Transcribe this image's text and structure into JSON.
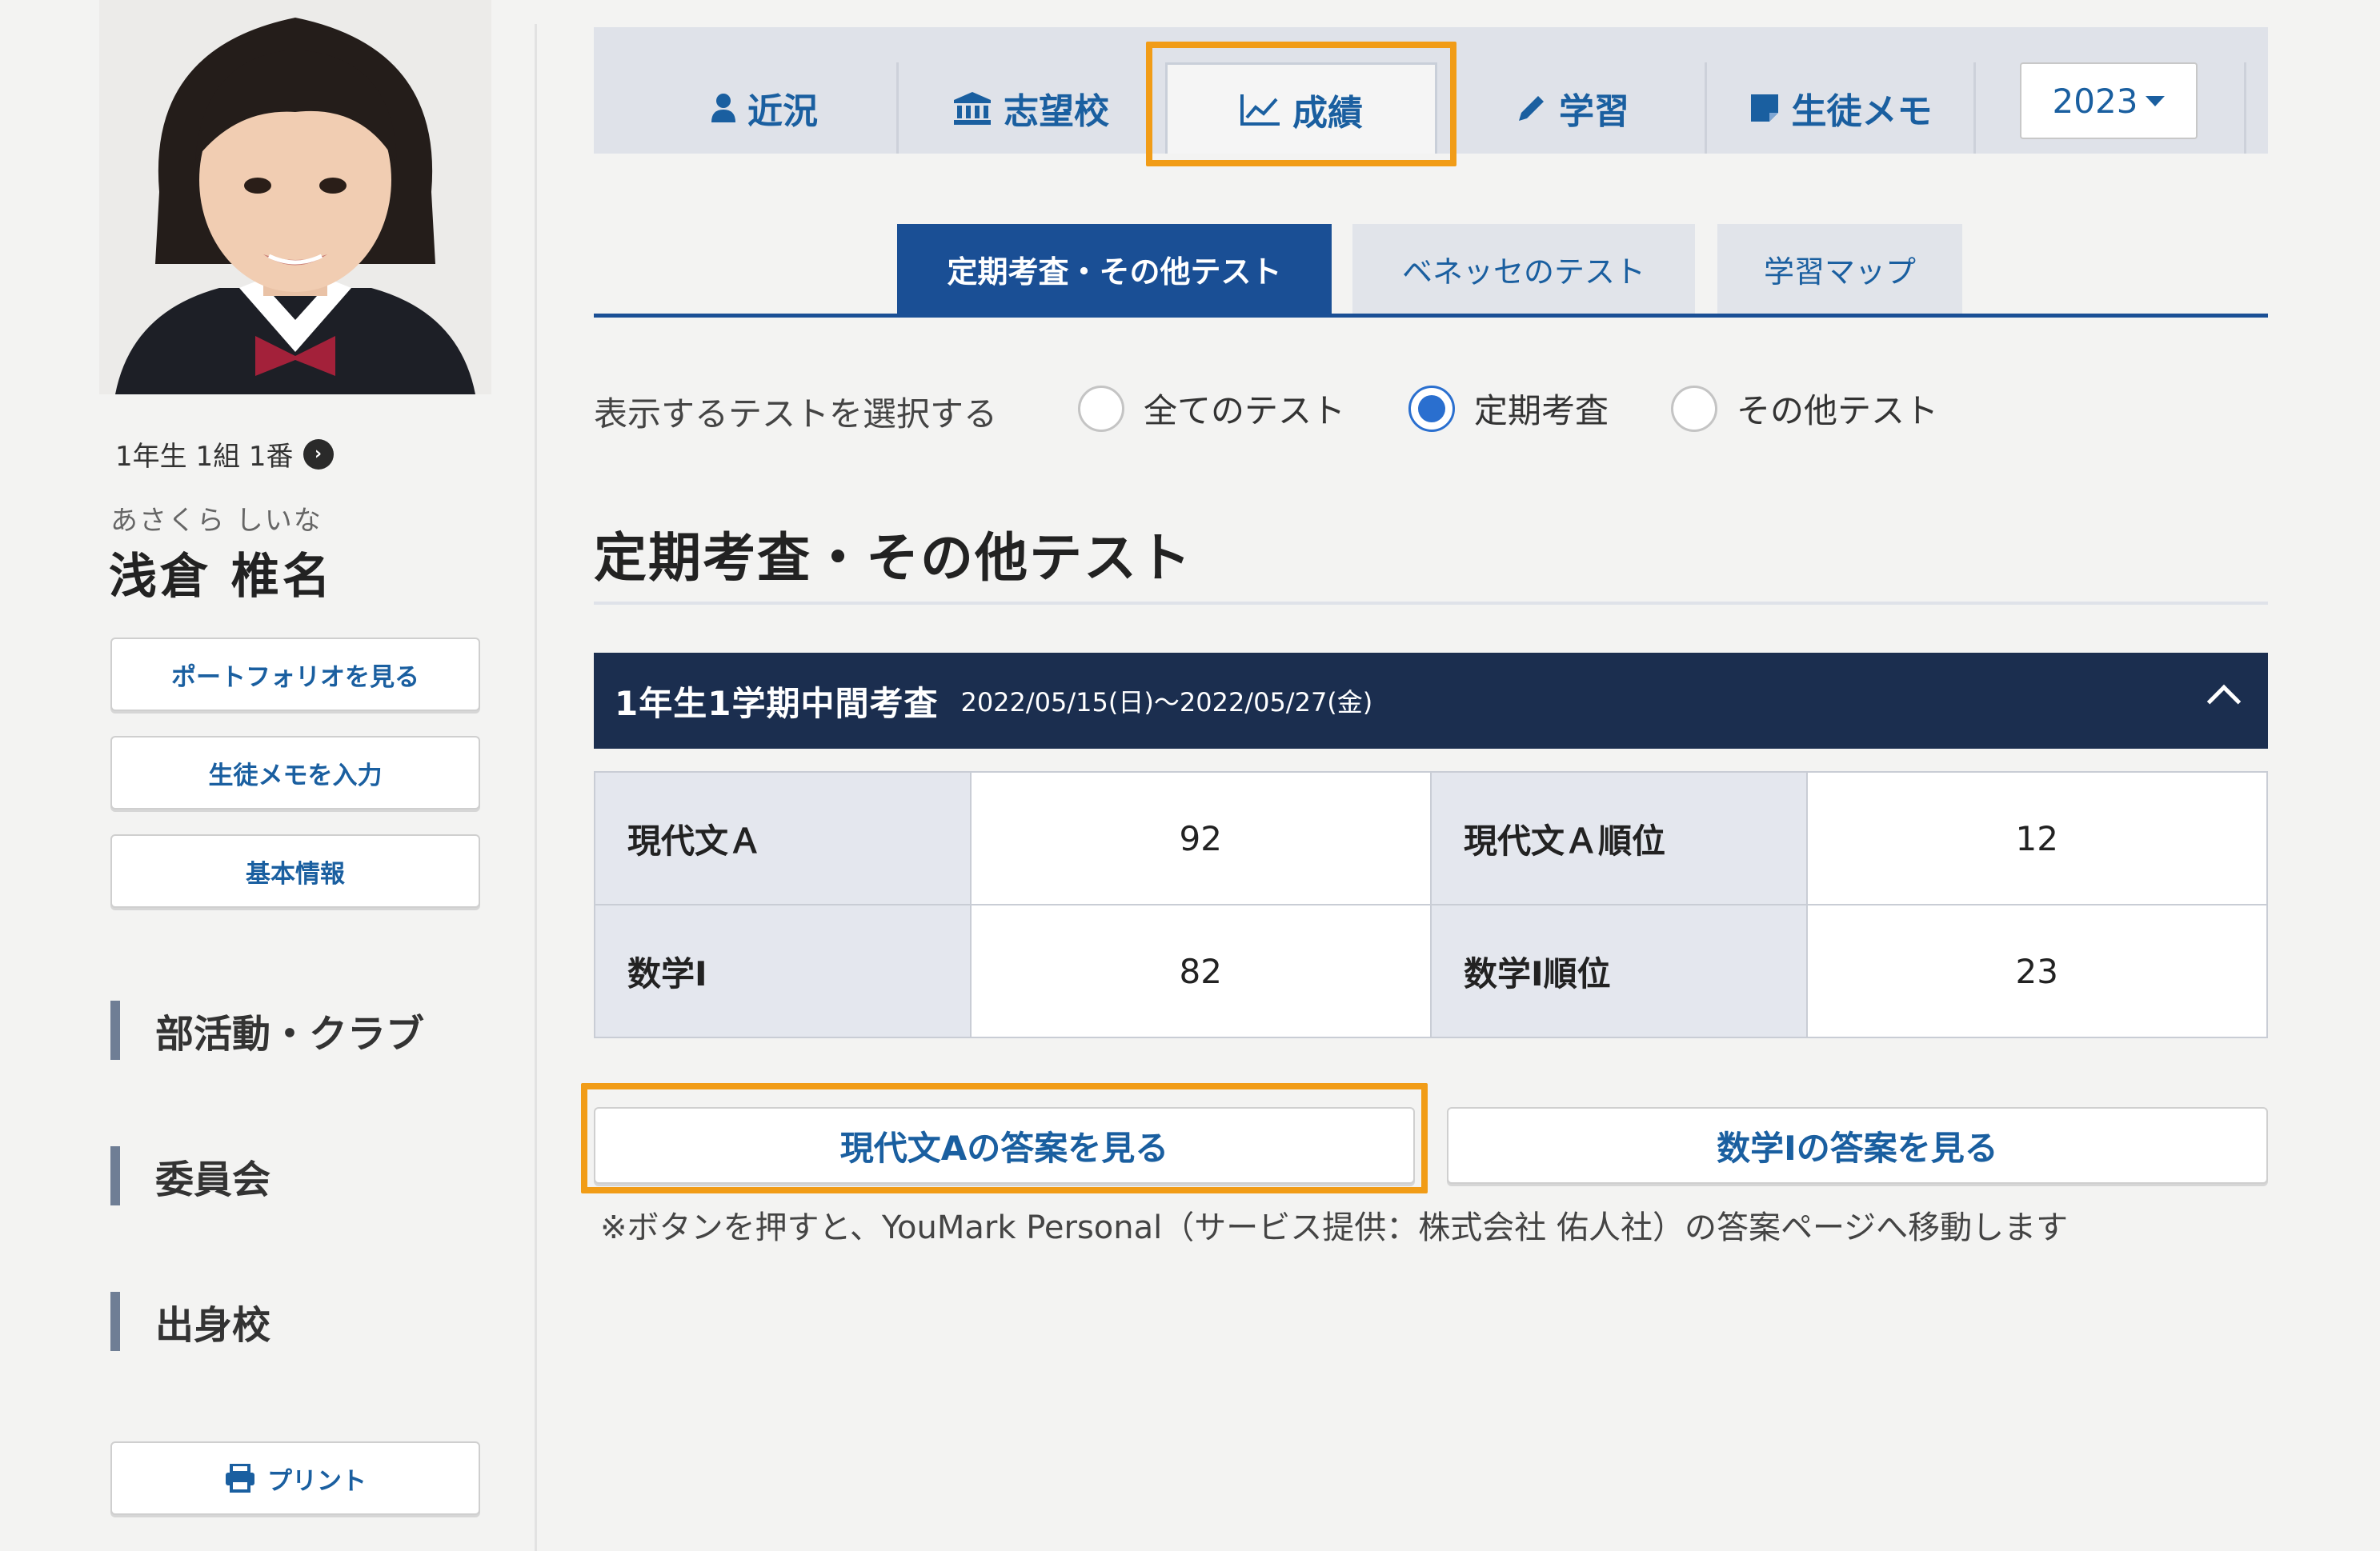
{
  "student": {
    "class_line": "1年生 1組 1番",
    "furigana": "あさくら しいな",
    "name": "浅倉 椎名"
  },
  "sidebar": {
    "buttons": [
      {
        "label": "ポートフォリオを見る"
      },
      {
        "label": "生徒メモを入力"
      },
      {
        "label": "基本情報"
      }
    ],
    "sections": [
      {
        "label": "部活動・クラブ"
      },
      {
        "label": "委員会"
      },
      {
        "label": "出身校"
      }
    ],
    "print_label": "プリント"
  },
  "tabs": [
    {
      "label": "近況",
      "icon": "user-icon"
    },
    {
      "label": "志望校",
      "icon": "school-icon"
    },
    {
      "label": "成績",
      "icon": "chart-line-icon",
      "active": true
    },
    {
      "label": "学習",
      "icon": "pencil-icon"
    },
    {
      "label": "生徒メモ",
      "icon": "memo-icon"
    }
  ],
  "year_select": {
    "value": "2023"
  },
  "subtabs": [
    {
      "label": "定期考査・その他テスト",
      "active": true
    },
    {
      "label": "ベネッセのテスト"
    },
    {
      "label": "学習マップ"
    }
  ],
  "radio_filter": {
    "prompt": "表示するテストを選択する",
    "options": [
      {
        "label": "全てのテスト",
        "selected": false
      },
      {
        "label": "定期考査",
        "selected": true
      },
      {
        "label": "その他テスト",
        "selected": false
      }
    ]
  },
  "section_title": "定期考査・その他テスト",
  "exam": {
    "name": "1年生1学期中間考査",
    "dates": "2022/05/15(日)〜2022/05/27(金)",
    "rows": [
      {
        "subject": "現代文Ａ",
        "score": "92",
        "rank_label": "現代文Ａ順位",
        "rank": "12"
      },
      {
        "subject": "数学Ⅰ",
        "score": "82",
        "rank_label": "数学Ⅰ順位",
        "rank": "23"
      }
    ]
  },
  "answer_buttons": [
    {
      "label": "現代文Aの答案を見る"
    },
    {
      "label": "数学Iの答案を見る"
    }
  ],
  "note": "※ボタンを押すと、YouMark Personal（サービス提供：株式会社 佑人社）の答案ページへ移動します",
  "colors": {
    "highlight": "#f19c17",
    "primary": "#1a5fa0",
    "navy": "#1b2e4f"
  }
}
